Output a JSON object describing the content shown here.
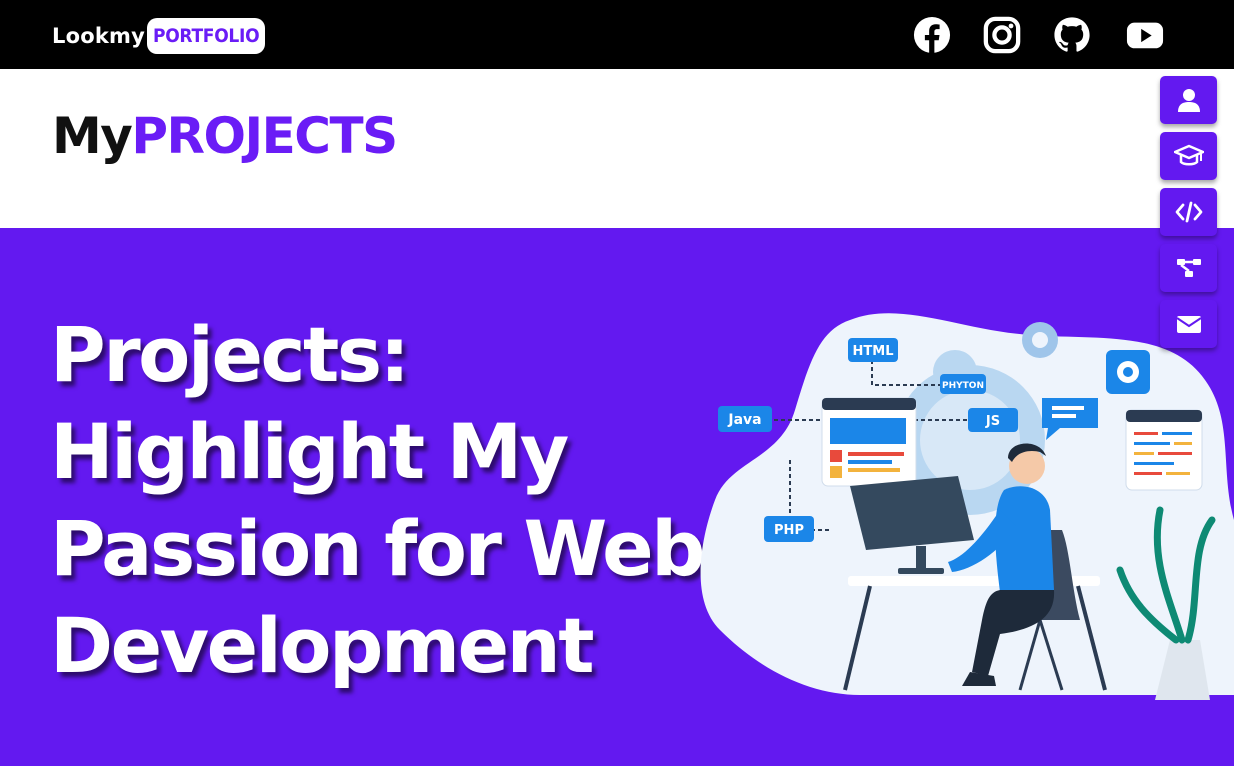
{
  "brand": {
    "prefix": "Lookmy",
    "highlight": "PORTFOLIO"
  },
  "social": [
    {
      "name": "facebook-icon"
    },
    {
      "name": "instagram-icon"
    },
    {
      "name": "github-icon"
    },
    {
      "name": "youtube-icon"
    }
  ],
  "page_title": {
    "first": "My",
    "second": "PROJECTS"
  },
  "hero": {
    "headline_lines": [
      "Projects:",
      "Highlight My",
      "Passion for Web",
      "Development"
    ],
    "illustration_labels": {
      "html": "HTML",
      "phyton": "PHYTON",
      "js": "JS",
      "java": "Java",
      "php": "PHP"
    }
  },
  "sidenav": [
    {
      "name": "user-icon"
    },
    {
      "name": "graduation-cap-icon"
    },
    {
      "name": "code-icon"
    },
    {
      "name": "project-diagram-icon"
    },
    {
      "name": "envelope-icon"
    }
  ],
  "colors": {
    "accent": "#6319f0",
    "brand_text": "#6a1cf6",
    "topbar": "#000000"
  }
}
